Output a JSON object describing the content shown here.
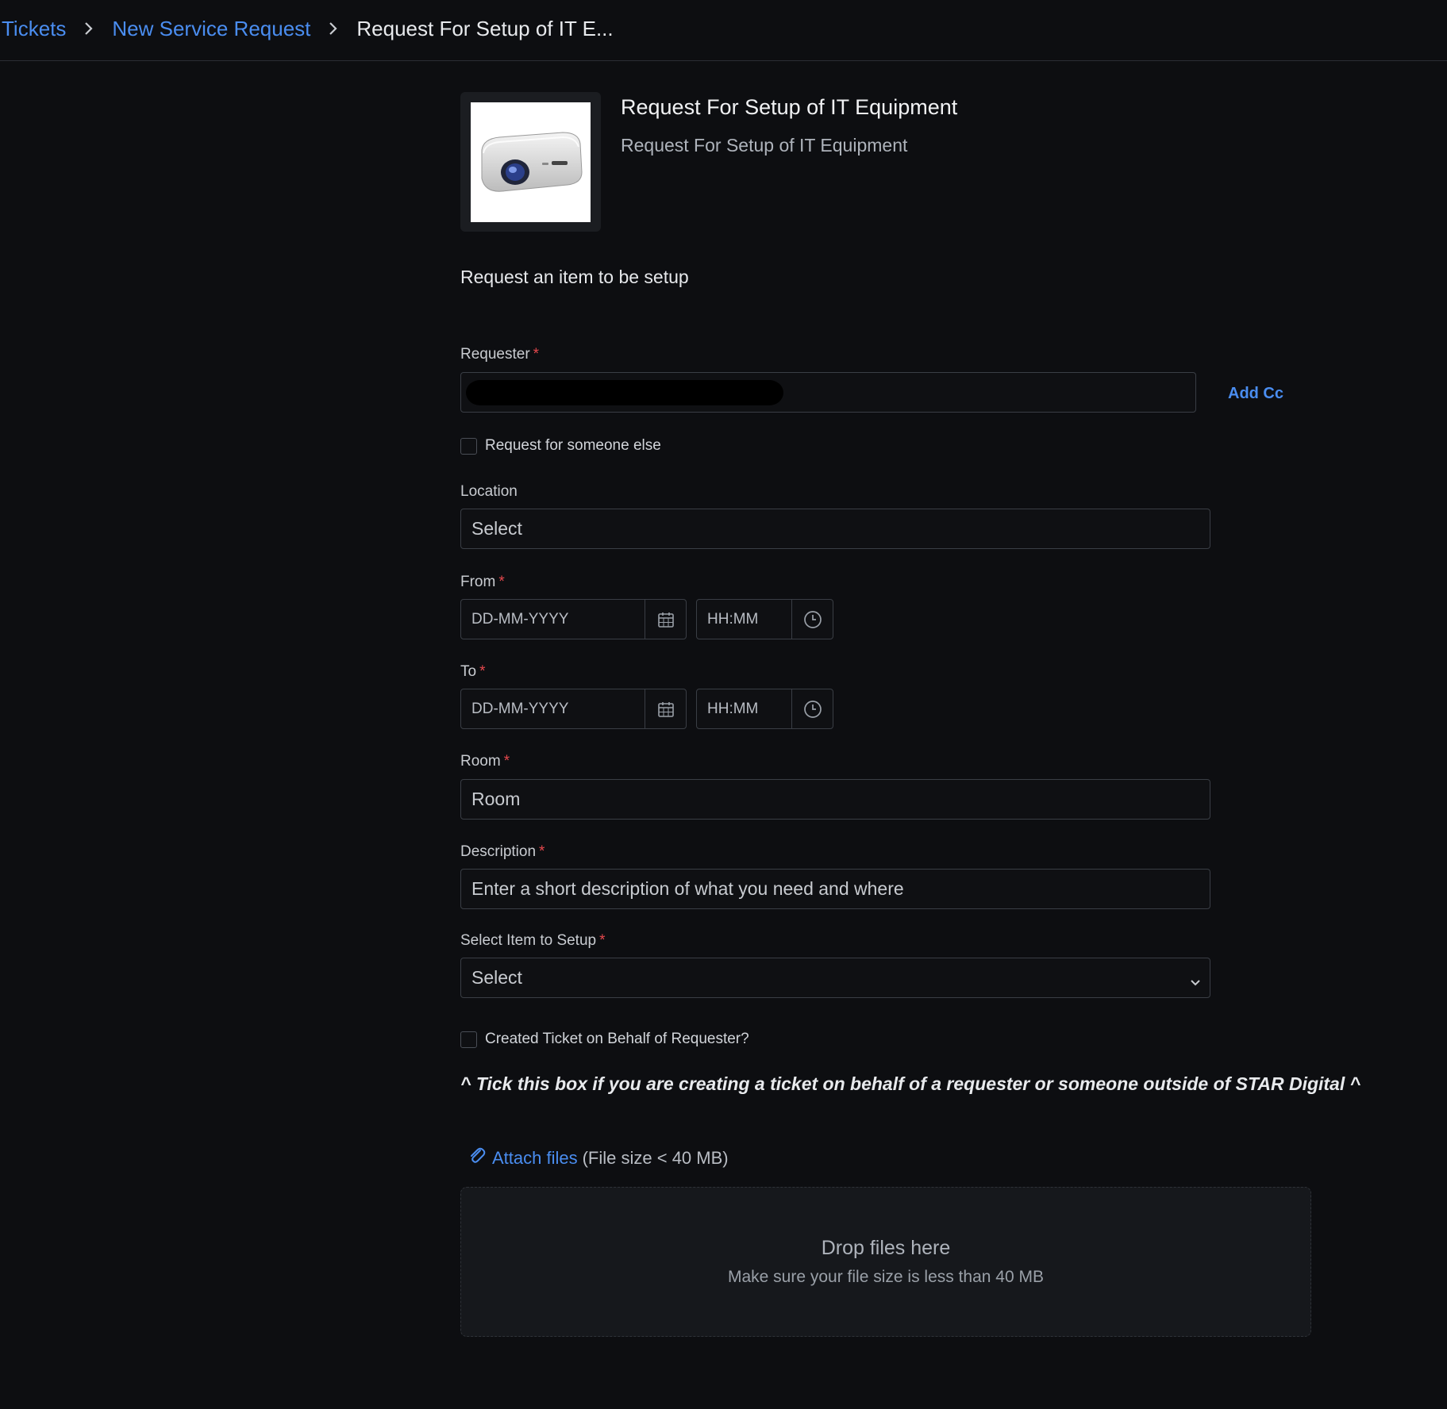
{
  "breadcrumb": {
    "items": [
      "Tickets",
      "New Service Request",
      "Request For Setup of IT E..."
    ]
  },
  "header": {
    "title": "Request For Setup of IT Equipment",
    "subtitle": "Request For Setup of IT Equipment",
    "image": "projector-image"
  },
  "intro_text": "Request an item to be setup",
  "form": {
    "requester": {
      "label": "Requester",
      "required": true,
      "value": ""
    },
    "add_cc": "Add Cc",
    "request_for_someone_else": {
      "label": "Request for someone else",
      "checked": false
    },
    "location": {
      "label": "Location",
      "placeholder": "Select"
    },
    "from": {
      "label": "From",
      "required": true,
      "date_placeholder": "DD-MM-YYYY",
      "time_placeholder": "HH:MM"
    },
    "to": {
      "label": "To",
      "required": true,
      "date_placeholder": "DD-MM-YYYY",
      "time_placeholder": "HH:MM"
    },
    "room": {
      "label": "Room",
      "required": true,
      "placeholder": "Room"
    },
    "description": {
      "label": "Description",
      "required": true,
      "placeholder": "Enter a short description of what you need and where"
    },
    "select_item": {
      "label": "Select Item to Setup",
      "required": true,
      "placeholder": "Select"
    },
    "created_on_behalf": {
      "label": "Created Ticket on Behalf of Requester?",
      "checked": false
    },
    "hint": "^ Tick this box if you are creating a ticket on behalf of a requester or someone outside of STAR Digital ^"
  },
  "attachments": {
    "link": "Attach files",
    "note": "(File size < 40 MB)",
    "drop_title": "Drop files here",
    "drop_subtitle": "Make sure your file size is less than 40 MB"
  },
  "colors": {
    "background": "#0d0e11",
    "accent": "#4a8df0",
    "required": "#e5484d",
    "border": "#3a3e45"
  },
  "icons": [
    "chevron-right-icon",
    "calendar-icon",
    "clock-icon",
    "chevron-down-icon",
    "paperclip-icon"
  ]
}
